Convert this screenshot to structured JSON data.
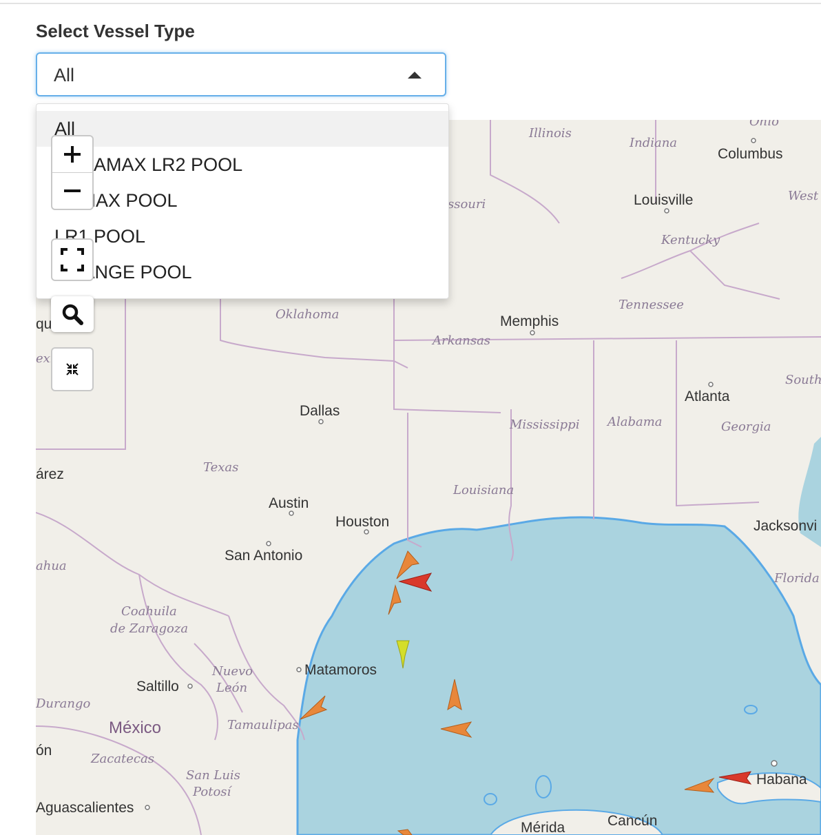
{
  "form": {
    "label": "Select Vessel Type",
    "selected": "All",
    "options": [
      "All",
      "DYNAMAX LR2 POOL",
      "DYMAX POOL",
      "LR1 POOL",
      "ORANGE POOL"
    ]
  },
  "map_controls": {
    "zoom_in": "zoom-in-icon",
    "zoom_out": "zoom-out-icon",
    "fullscreen": "fullscreen-icon",
    "search": "search-icon",
    "collapse": "collapse-icon"
  },
  "map": {
    "cities": [
      "Columbus",
      "Louisville",
      "Memphis",
      "Atlanta",
      "Dallas",
      "Austin",
      "Houston",
      "San Antonio",
      "Jacksonvi",
      "Matamoros",
      "Saltillo",
      "Aguascalientes",
      "Habana",
      "Mérida",
      "Cancún"
    ],
    "regions": [
      "Illinois",
      "Indiana",
      "Ohio",
      "West",
      "ssouri",
      "Kentucky",
      "Tennessee",
      "Oklahoma",
      "Arkansas",
      "South",
      "Mississippi",
      "Alabama",
      "Georgia",
      "Texas",
      "Louisiana",
      "Florida",
      "Coahuila",
      "de Zaragoza",
      "Nuevo",
      "León",
      "Tamaulipas",
      "Durango",
      "Zacatecas",
      "San Luis",
      "Potosí",
      "ahua",
      "exi"
    ],
    "country": "México",
    "partial": [
      "árez",
      "ón",
      "qu"
    ],
    "colors": {
      "land": "#f1efe9",
      "water": "#aad3df",
      "coast": "#5aa9e6",
      "border": "#c7a9cb",
      "vessel_orange": "#e8873a",
      "vessel_red": "#d9392b",
      "vessel_yellow": "#d4de2a"
    }
  }
}
